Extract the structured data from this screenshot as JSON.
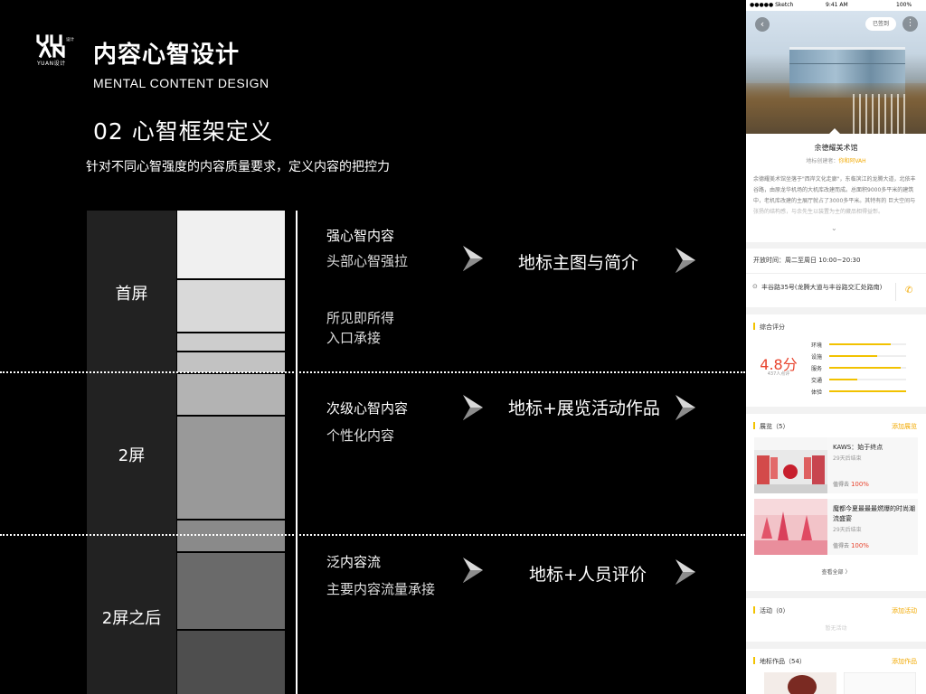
{
  "slide": {
    "logo_text": "YUAN设计",
    "title": "内容心智设计",
    "subtitle": "MENTAL CONTENT DESIGN",
    "section_title": "02 心智框架定义",
    "section_desc": "针对不同心智强度的内容质量要求，定义内容的把控力",
    "screen_labels": [
      "首屏",
      "2屏",
      "2屏之后"
    ],
    "rows": [
      {
        "title": "强心智内容",
        "subtitle": "头部心智强拉",
        "result": "地标主图与简介"
      },
      {
        "title": "所见即所得",
        "subtitle": "入口承接"
      },
      {
        "title": "次级心智内容",
        "subtitle": "个性化内容",
        "result": "地标+展览活动作品"
      },
      {
        "title": "泛内容流",
        "subtitle": "主要内容流量承接",
        "result": "地标+人员评价"
      }
    ]
  },
  "phone": {
    "status": {
      "carrier": "●●●●● Sketch",
      "time": "9:41 AM",
      "battery": "100%"
    },
    "checkin_label": "已签到",
    "venue_name": "余德耀美术馆",
    "creator_label": "地标创建者：",
    "creator_name": "你和阿VAH",
    "description": "余德耀美术馆坐落于\"西岸文化走廊\"，东临滨江的龙腾大道，北依丰谷路，由原龙华机场的大机库改建而成。总面积9000多平米的建筑中，老机库改建的主展厅就占了3000多平米。其特有的 巨大空间与张扬的结构感，与余先生以装置为主的藏品相得益彰。",
    "hours": "开放时间：周二至周日  10:00~20:30",
    "address": "丰谷路35号(龙腾大道与丰谷路交汇处路南)",
    "rating": {
      "title": "综合评分",
      "score": "4.8分",
      "count": "437人点评",
      "items": [
        {
          "label": "环境",
          "value": 0.8
        },
        {
          "label": "设施",
          "value": 0.62
        },
        {
          "label": "服务",
          "value": 0.93
        },
        {
          "label": "交通",
          "value": 0.36
        },
        {
          "label": "体验",
          "value": 1.0
        }
      ]
    },
    "exhibits": {
      "title": "展览（5）",
      "action": "添加展览",
      "items": [
        {
          "title": "KAWS：始于终点",
          "days": "29天后结束",
          "worth": "值得去",
          "percent": "100%"
        },
        {
          "title": "魔都今夏最最最燃爆的时尚潮流盛宴",
          "days": "29天后结束",
          "worth": "值得去",
          "percent": "100%"
        }
      ],
      "see_all": "查看全部 〉"
    },
    "activity": {
      "title": "活动（0）",
      "action": "添加活动",
      "empty": "暂无活动"
    },
    "works": {
      "title": "地标作品（54）",
      "action": "添加作品"
    }
  },
  "colors": {
    "accent": "#f2c200",
    "accent_text": "#f2a900",
    "score_red": "#e8442e"
  },
  "icons": [
    "back-arrow-icon",
    "more-dots-icon",
    "location-pin-icon",
    "phone-icon",
    "chevron-right-icon",
    "expand-chevron-icon"
  ]
}
